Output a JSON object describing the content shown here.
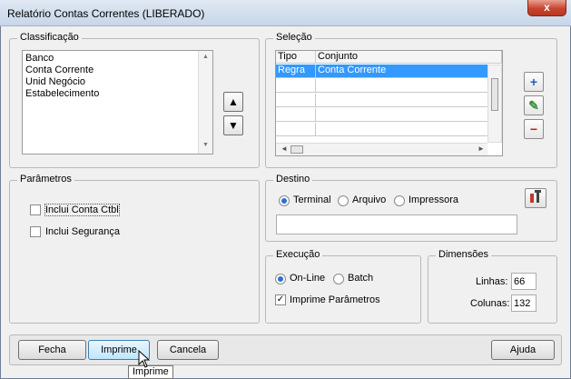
{
  "window": {
    "title": "Relatório Contas Correntes (LIBERADO)",
    "close_glyph": "x"
  },
  "classificacao": {
    "legend": "Classificação",
    "items": [
      "Banco",
      "Conta Corrente",
      "Unid Negócio",
      "Estabelecimento"
    ],
    "up_glyph": "▲",
    "down_glyph": "▼"
  },
  "selecao": {
    "legend": "Seleção",
    "columns": [
      "Tipo",
      "Conjunto"
    ],
    "rows": [
      {
        "tipo": "Regra",
        "conjunto": "Conta Corrente"
      }
    ],
    "add_glyph": "+",
    "edit_glyph": "✎",
    "remove_glyph": "−"
  },
  "parametros": {
    "legend": "Parâmetros",
    "options": [
      {
        "label": "Inclui Conta Ctbl",
        "checked": false
      },
      {
        "label": "Inclui Segurança",
        "checked": false
      }
    ]
  },
  "destino": {
    "legend": "Destino",
    "options": [
      "Terminal",
      "Arquivo",
      "Impressora"
    ],
    "selected": "Terminal",
    "path_value": ""
  },
  "execucao": {
    "legend": "Execução",
    "options": [
      "On-Line",
      "Batch"
    ],
    "selected": "On-Line",
    "imprime_parametros_label": "Imprime Parâmetros",
    "imprime_parametros_checked": true,
    "check_glyph": "✓"
  },
  "dimensoes": {
    "legend": "Dimensões",
    "linhas_label": "Linhas:",
    "linhas_value": "66",
    "colunas_label": "Colunas:",
    "colunas_value": "132"
  },
  "buttons": {
    "fecha": "Fecha",
    "imprime": "Imprime",
    "cancela": "Cancela",
    "ajuda": "Ajuda"
  },
  "tooltip": "Imprime"
}
